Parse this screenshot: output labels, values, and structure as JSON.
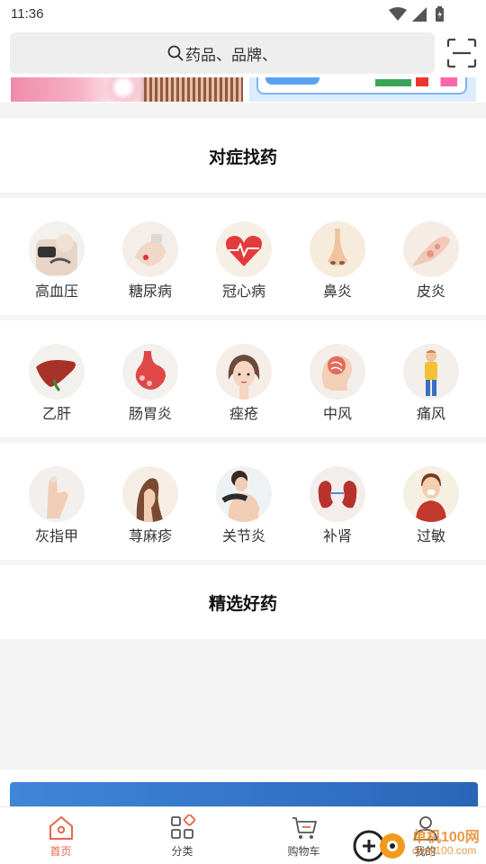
{
  "status_bar": {
    "time": "11:36"
  },
  "search": {
    "placeholder": "药品、品牌、"
  },
  "sections": {
    "symptoms_title": "对症找药",
    "featured_title": "精选好药"
  },
  "symptoms": [
    [
      {
        "label": "高血压",
        "icon": "blood-pressure-icon"
      },
      {
        "label": "糖尿病",
        "icon": "diabetes-icon"
      },
      {
        "label": "冠心病",
        "icon": "heart-disease-icon"
      },
      {
        "label": "鼻炎",
        "icon": "nose-icon"
      },
      {
        "label": "皮炎",
        "icon": "skin-icon"
      }
    ],
    [
      {
        "label": "乙肝",
        "icon": "liver-icon"
      },
      {
        "label": "肠胃炎",
        "icon": "stomach-icon"
      },
      {
        "label": "痤疮",
        "icon": "acne-icon"
      },
      {
        "label": "中风",
        "icon": "brain-icon"
      },
      {
        "label": "痛风",
        "icon": "gout-icon"
      }
    ],
    [
      {
        "label": "灰指甲",
        "icon": "nail-fungus-icon"
      },
      {
        "label": "荨麻疹",
        "icon": "hives-icon"
      },
      {
        "label": "关节炎",
        "icon": "joint-icon"
      },
      {
        "label": "补肾",
        "icon": "kidney-icon"
      },
      {
        "label": "过敏",
        "icon": "allergy-icon"
      }
    ]
  ],
  "tabs": [
    {
      "label": "首页",
      "icon": "home-icon",
      "active": true
    },
    {
      "label": "分类",
      "icon": "category-icon",
      "active": false
    },
    {
      "label": "购物车",
      "icon": "cart-icon",
      "active": false
    },
    {
      "label": "我的",
      "icon": "profile-icon",
      "active": false
    }
  ],
  "watermark": {
    "text": "单机100网",
    "sub": "danji100.com"
  },
  "colors": {
    "accent": "#e8654a",
    "background": "#f4f4f4",
    "banner_blue": "#3f86d9"
  }
}
